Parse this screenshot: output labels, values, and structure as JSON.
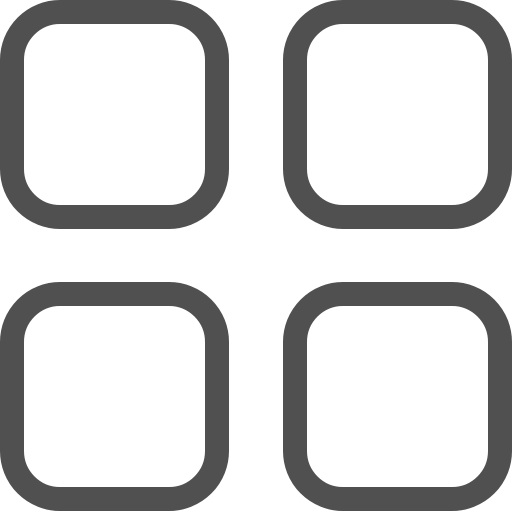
{
  "icon": {
    "name": "grid-view-icon",
    "stroke_color": "#505050",
    "background_color": "#ffffff",
    "tiles": [
      {
        "name": "tile-top-left"
      },
      {
        "name": "tile-top-right"
      },
      {
        "name": "tile-bottom-left"
      },
      {
        "name": "tile-bottom-right"
      }
    ]
  }
}
